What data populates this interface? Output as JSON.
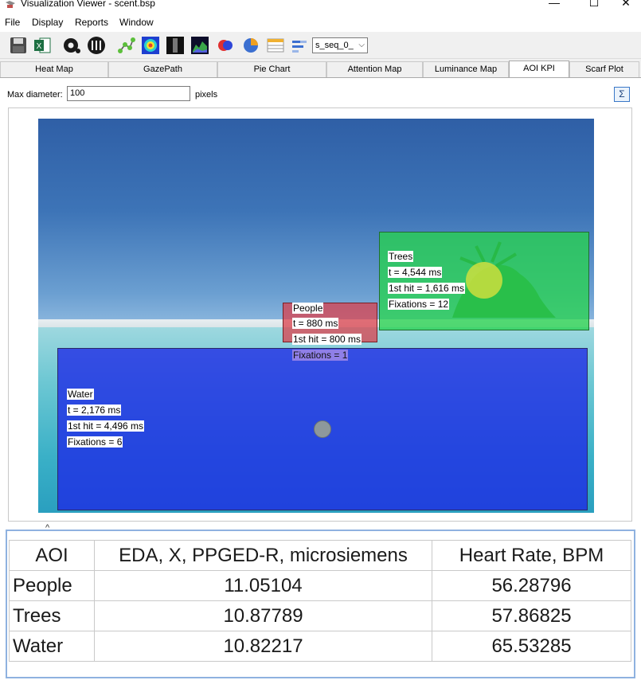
{
  "window": {
    "title": "Visualization Viewer - scent.bsp",
    "minimize": "—",
    "maximize": "☐",
    "close": "✕"
  },
  "menu": [
    "File",
    "Display",
    "Reports",
    "Window"
  ],
  "toolbar": {
    "select_value": "s_seq_0_"
  },
  "tabs": [
    {
      "label": "Heat Map"
    },
    {
      "label": "GazePath"
    },
    {
      "label": "Pie Chart"
    },
    {
      "label": "Attention Map"
    },
    {
      "label": "Luminance Map"
    },
    {
      "label": "AOI KPI"
    },
    {
      "label": "Scarf Plot"
    }
  ],
  "panel": {
    "max_diameter_label": "Max diameter:",
    "max_diameter_value": "100",
    "unit": "pixels",
    "sigma": "Σ"
  },
  "aois": {
    "water": {
      "name": "Water",
      "t": "t = 2,176 ms",
      "first_hit": "1st hit = 4,496 ms",
      "fixations": "Fixations = 6"
    },
    "trees": {
      "name": "Trees",
      "t": "t = 4,544 ms",
      "first_hit": "1st hit = 1,616 ms",
      "fixations": "Fixations = 12"
    },
    "people": {
      "name": "People",
      "t": "t = 880 ms",
      "first_hit": "1st hit = 800 ms",
      "fixations": "Fixations = 1"
    }
  },
  "colors": {
    "water_aoi": "#1e28e6",
    "trees_aoi": "#28d250",
    "people_aoi": "#dc3c46",
    "fixation_trees": "#d7e13c",
    "fixation_water": "#96a096"
  },
  "kpi_table": {
    "headers": [
      "AOI",
      "EDA, X, PPGED-R, microsiemens",
      "Heart Rate, BPM"
    ],
    "rows": [
      [
        "People",
        "11.05104",
        "56.28796"
      ],
      [
        "Trees",
        "10.87789",
        "57.86825"
      ],
      [
        "Water",
        "10.82217",
        "65.53285"
      ]
    ]
  }
}
